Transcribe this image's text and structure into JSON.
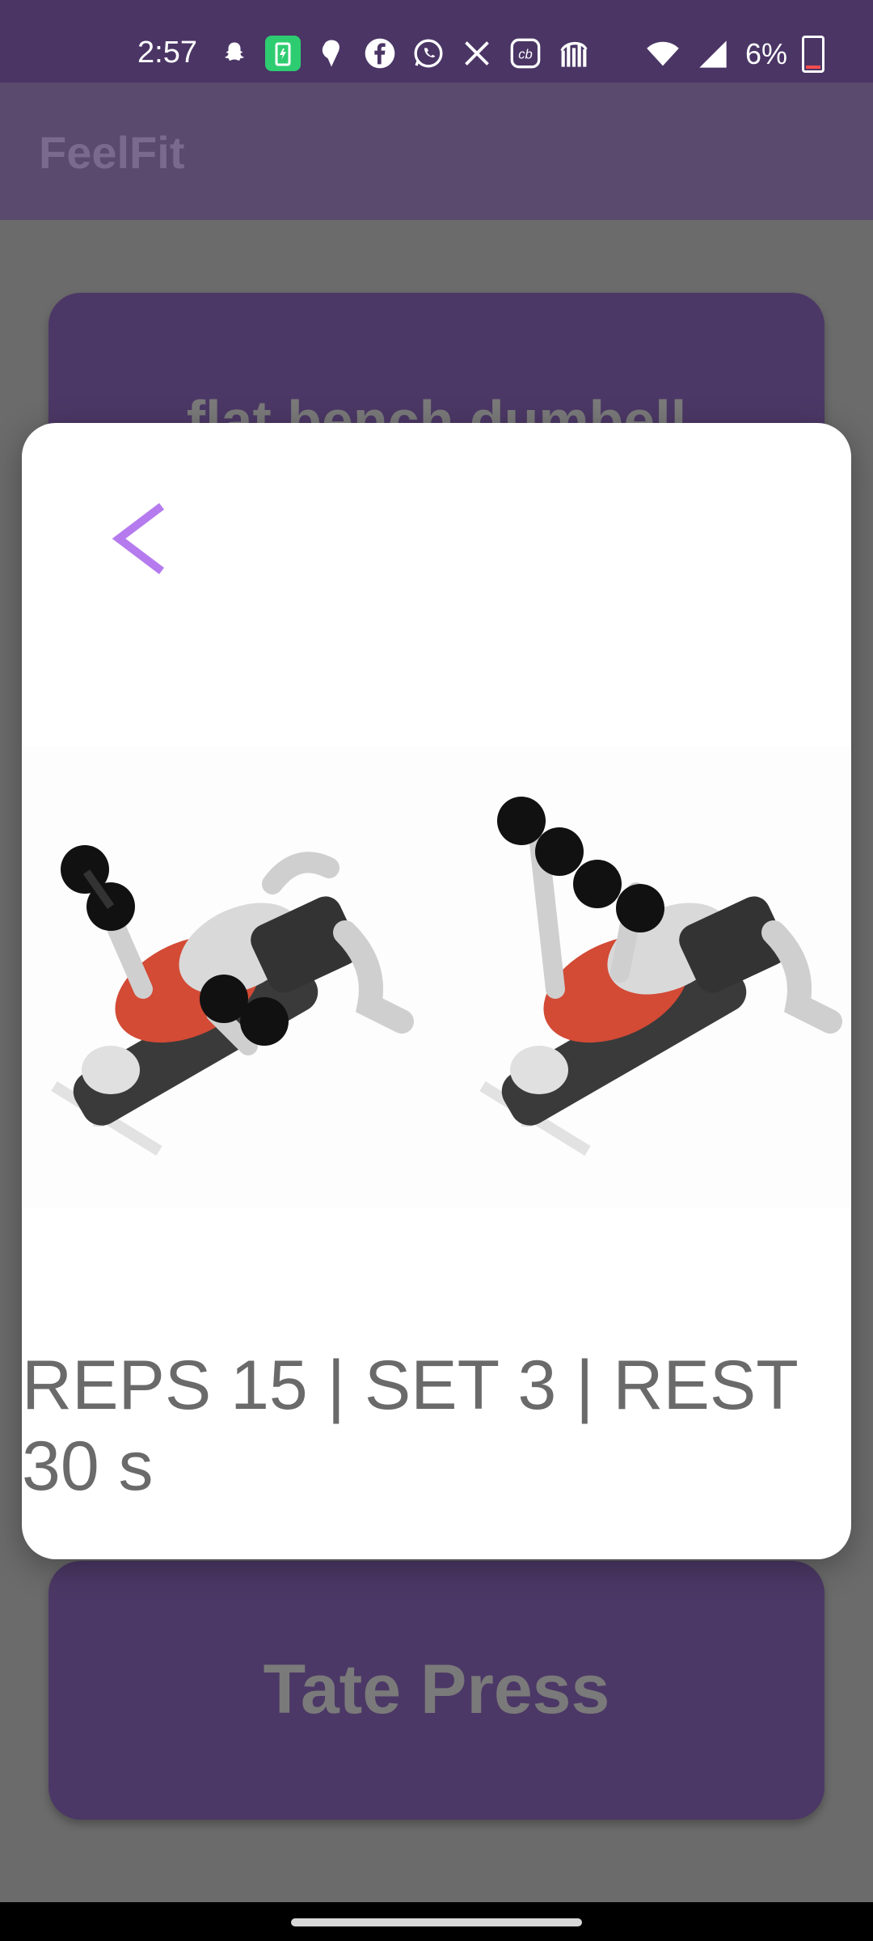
{
  "status_bar": {
    "time": "2:57",
    "battery_percent": "6%"
  },
  "app_bar": {
    "title": "FeelFit"
  },
  "background_cards": [
    {
      "title": "flat bench dumbell"
    },
    {
      "title": "Tate Press"
    }
  ],
  "modal": {
    "back_icon": "chevron-left-icon",
    "illustration": "flat-bench-dumbbell-fly-illustration",
    "info": "REPS 15 | SET 3 | REST 30 s"
  },
  "colors": {
    "accent": "#b57bee",
    "status_bar": "#4a3565",
    "card": "#4c3866"
  }
}
